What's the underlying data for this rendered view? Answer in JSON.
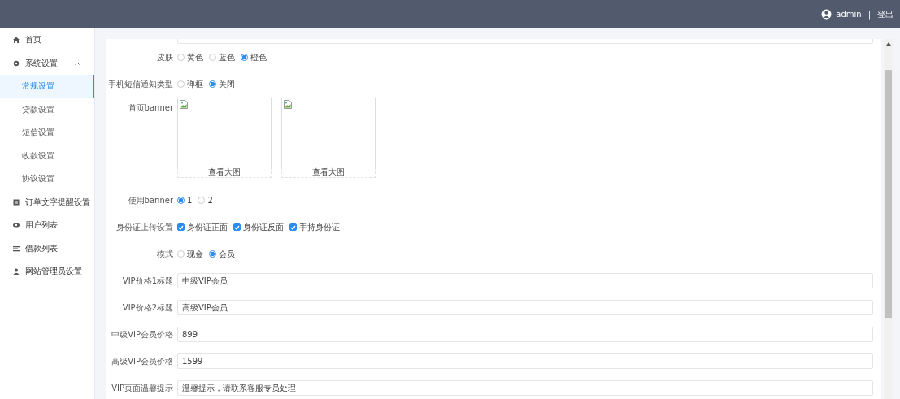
{
  "header": {
    "user": "admin",
    "separator": "|",
    "logout": "登出"
  },
  "sidebar": {
    "items": [
      {
        "label": "首页",
        "kind": "home",
        "selected": false
      },
      {
        "label": "系统设置",
        "kind": "gear",
        "selected": false,
        "expanded": true,
        "children": [
          {
            "label": "常规设置",
            "selected": true
          },
          {
            "label": "贷款设置",
            "selected": false
          },
          {
            "label": "短信设置",
            "selected": false
          },
          {
            "label": "收款设置",
            "selected": false
          },
          {
            "label": "协议设置",
            "selected": false
          }
        ]
      },
      {
        "label": "订单文字提醒设置",
        "kind": "doc",
        "selected": false
      },
      {
        "label": "用户列表",
        "kind": "eye",
        "selected": false
      },
      {
        "label": "借款列表",
        "kind": "lines",
        "selected": false
      },
      {
        "label": "网站管理员设置",
        "kind": "user",
        "selected": false
      }
    ]
  },
  "form": {
    "fields": [
      {
        "kind": "cut"
      },
      {
        "kind": "radio",
        "label": "皮肤",
        "options": [
          {
            "label": "黄色",
            "selected": false
          },
          {
            "label": "蓝色",
            "selected": false
          },
          {
            "label": "橙色",
            "selected": true
          }
        ]
      },
      {
        "kind": "radio",
        "label": "手机短信通知类型",
        "options": [
          {
            "label": "弹框",
            "selected": false
          },
          {
            "label": "关闭",
            "selected": true
          }
        ]
      },
      {
        "kind": "images",
        "label": "首页banner",
        "images": [
          {
            "caption": "查看大图"
          },
          {
            "caption": "查看大图"
          }
        ]
      },
      {
        "kind": "radio",
        "label": "使用banner",
        "options": [
          {
            "label": "1",
            "selected": true
          },
          {
            "label": "2",
            "selected": false
          }
        ]
      },
      {
        "kind": "checkbox",
        "label": "身份证上传设置",
        "options": [
          {
            "label": "身份证正面",
            "checked": true
          },
          {
            "label": "身份证反面",
            "checked": true
          },
          {
            "label": "手持身份证",
            "checked": true
          }
        ]
      },
      {
        "kind": "radio",
        "label": "模式",
        "options": [
          {
            "label": "现金",
            "selected": false
          },
          {
            "label": "会员",
            "selected": true
          }
        ]
      },
      {
        "kind": "input",
        "label": "VIP价格1标题",
        "value": "中级VIP会员"
      },
      {
        "kind": "input",
        "label": "VIP价格2标题",
        "value": "高级VIP会员"
      },
      {
        "kind": "input",
        "label": "中级VIP会员价格",
        "value": "899"
      },
      {
        "kind": "input",
        "label": "高级VIP会员价格",
        "value": "1599"
      },
      {
        "kind": "input",
        "label": "VIP页面温馨提示",
        "value": "温馨提示，请联系客服专员处理"
      }
    ]
  }
}
